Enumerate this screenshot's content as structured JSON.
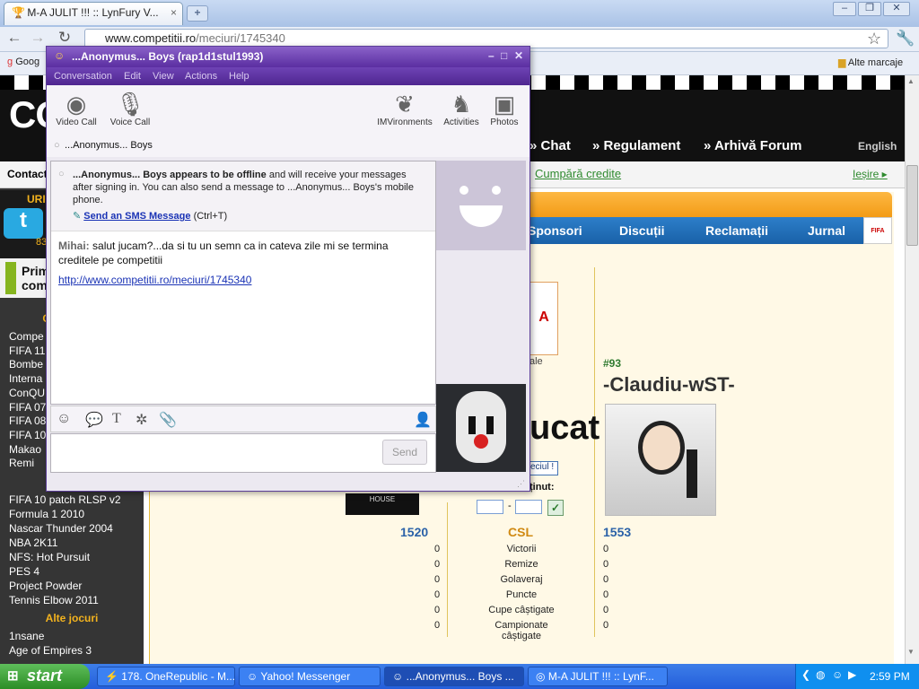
{
  "browser": {
    "tab_title": "M-A JULIT !!! :: LynFury V...",
    "url_host": "www.competitii.ro",
    "url_path": "/meciuri/1745340",
    "bookmark_left": "Goog",
    "bookmark_other": "Alte marcaje"
  },
  "site": {
    "logo": "CO",
    "nav": [
      "Chat",
      "Regulament",
      "Arhivă Forum"
    ],
    "language": "English",
    "contact": "Contact",
    "buy_credits": "Cumpără credite",
    "logout": "Ieșire",
    "tabs": [
      "Sponsori",
      "Discuții",
      "Reclamații",
      "Jurnal"
    ],
    "sidebar_top": "URI",
    "sidebar_count": "83",
    "promo_line1": "Prim",
    "promo_line2": "com",
    "section_heading": "Cele",
    "games": [
      "Compe",
      "FIFA 11",
      "Bombe",
      "Interna",
      "ConQU",
      "FIFA 07",
      "FIFA 08",
      "FIFA 10",
      "Makao",
      "Remi"
    ],
    "games2": [
      "FIFA 10 patch RLSP v2",
      "Formula 1 2010",
      "Nascar Thunder 2004",
      "NBA 2K11",
      "NFS: Hot Pursuit",
      "PES 4",
      "Project Powder",
      "Tennis Elbow 2011"
    ],
    "other_games_heading": "Alte jocuri",
    "games3": [
      "1nsane",
      "Age of Empires 3"
    ],
    "match_big_text": "ucat",
    "fifa_label": "ale",
    "score_label": "ținut:",
    "ok_label": "eciul !",
    "house_label": "HOUSE",
    "player_rank": "#93",
    "player_name": "-Claudiu-wST-",
    "left_score": "1520",
    "game_tag": "CSL",
    "right_score": "1553",
    "stats": [
      "Victorii",
      "Remize",
      "Golaveraj",
      "Puncte",
      "Cupe câștigate",
      "Campionate câștigate"
    ],
    "stat_left": [
      "0",
      "0",
      "0",
      "0",
      "0",
      "0"
    ],
    "stat_right": [
      "0",
      "0",
      "0",
      "0",
      "0",
      "0"
    ]
  },
  "messenger": {
    "title": "...Anonymus... Boys (rap1d1stul1993)",
    "menu": [
      "Conversation",
      "Edit",
      "View",
      "Actions",
      "Help"
    ],
    "tools": {
      "video": "Video Call",
      "voice": "Voice Call",
      "imvironments": "IMVironments",
      "activities": "Activities",
      "photos": "Photos"
    },
    "recipient": "...Anonymus... Boys",
    "offline_bold": "...Anonymus... Boys appears to be offline",
    "offline_rest": "and will receive your messages after signing in. You can also send a message to ...Anonymus... Boys's mobile phone.",
    "sms_link": "Send an SMS Message",
    "sms_shortcut": "(Ctrl+T)",
    "sender": "Mihai:",
    "message": "salut jucam?...da si tu un semn ca in cateva zile mi se termina creditele pe competitii",
    "link": "http://www.competitii.ro/meciuri/1745340",
    "send": "Send"
  },
  "taskbar": {
    "start": "start",
    "tasks": [
      "178. OneRepublic - M...",
      "Yahoo! Messenger",
      "...Anonymus... Boys ...",
      "M-A JULIT !!! :: LynF..."
    ],
    "time": "2:59 PM"
  },
  "colors": {
    "site_accent": "#f3b31e",
    "site_blue": "#1961a8",
    "ym_purple": "#5b2ea1",
    "taskbar_blue": "#245edb"
  }
}
